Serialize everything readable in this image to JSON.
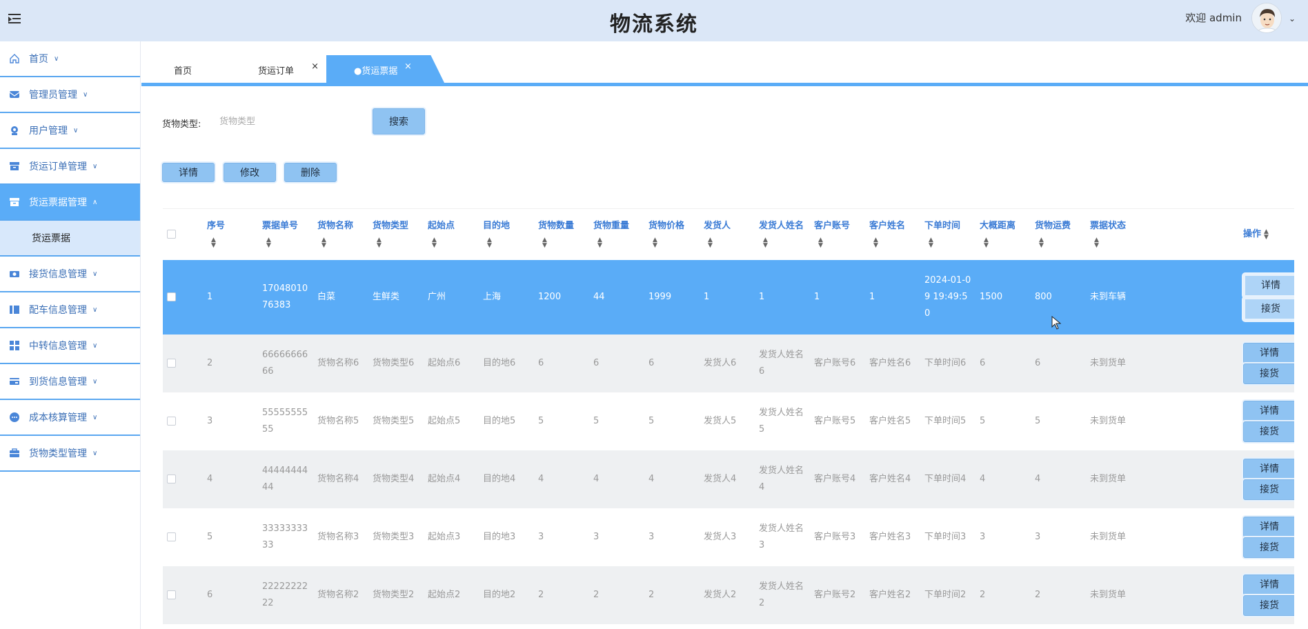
{
  "header": {
    "title": "物流系统",
    "welcome": "欢迎 admin"
  },
  "sidebar": {
    "items": [
      {
        "label": "首页",
        "icon": "home-icon"
      },
      {
        "label": "管理员管理",
        "icon": "admin-icon"
      },
      {
        "label": "用户管理",
        "icon": "user-icon"
      },
      {
        "label": "货运订单管理",
        "icon": "order-icon"
      },
      {
        "label": "货运票据管理",
        "icon": "ticket-icon",
        "active": true
      },
      {
        "label": "接货信息管理",
        "icon": "receive-icon"
      },
      {
        "label": "配车信息管理",
        "icon": "vehicle-icon"
      },
      {
        "label": "中转信息管理",
        "icon": "transfer-icon"
      },
      {
        "label": "到货信息管理",
        "icon": "arrival-icon"
      },
      {
        "label": "成本核算管理",
        "icon": "cost-icon"
      },
      {
        "label": "货物类型管理",
        "icon": "cargo-type-icon"
      }
    ],
    "sub_item": "货运票据"
  },
  "tabs": [
    {
      "label": "首页"
    },
    {
      "label": "货运订单",
      "close": "×"
    },
    {
      "label": "●货运票据",
      "close": "×",
      "active": true
    }
  ],
  "search": {
    "label": "货物类型:",
    "placeholder": "货物类型",
    "button": "搜索"
  },
  "actions": {
    "detail": "详情",
    "edit": "修改",
    "delete": "删除"
  },
  "table": {
    "columns": [
      "序号",
      "票据单号",
      "货物名称",
      "货物类型",
      "起始点",
      "目的地",
      "货物数量",
      "货物重量",
      "货物价格",
      "发货人",
      "发货人姓名",
      "客户账号",
      "客户姓名",
      "下单时间",
      "大概距离",
      "货物运费",
      "票据状态",
      "操作"
    ],
    "row_buttons": {
      "detail": "详情",
      "receive": "接货"
    },
    "rows": [
      {
        "cells": [
          "1",
          "1704801076383",
          "白菜",
          "生鲜类",
          "广州",
          "上海",
          "1200",
          "44",
          "1999",
          "1",
          "1",
          "1",
          "1",
          "2024-01-09 19:49:50",
          "1500",
          "800",
          "未到车辆"
        ],
        "selected": true
      },
      {
        "cells": [
          "2",
          "6666666666",
          "货物名称6",
          "货物类型6",
          "起始点6",
          "目的地6",
          "6",
          "6",
          "6",
          "发货人6",
          "发货人姓名6",
          "客户账号6",
          "客户姓名6",
          "下单时间6",
          "6",
          "6",
          "未到货单"
        ]
      },
      {
        "cells": [
          "3",
          "5555555555",
          "货物名称5",
          "货物类型5",
          "起始点5",
          "目的地5",
          "5",
          "5",
          "5",
          "发货人5",
          "发货人姓名5",
          "客户账号5",
          "客户姓名5",
          "下单时间5",
          "5",
          "5",
          "未到货单"
        ]
      },
      {
        "cells": [
          "4",
          "4444444444",
          "货物名称4",
          "货物类型4",
          "起始点4",
          "目的地4",
          "4",
          "4",
          "4",
          "发货人4",
          "发货人姓名4",
          "客户账号4",
          "客户姓名4",
          "下单时间4",
          "4",
          "4",
          "未到货单"
        ]
      },
      {
        "cells": [
          "5",
          "3333333333",
          "货物名称3",
          "货物类型3",
          "起始点3",
          "目的地3",
          "3",
          "3",
          "3",
          "发货人3",
          "发货人姓名3",
          "客户账号3",
          "客户姓名3",
          "下单时间3",
          "3",
          "3",
          "未到货单"
        ]
      },
      {
        "cells": [
          "6",
          "2222222222",
          "货物名称2",
          "货物类型2",
          "起始点2",
          "目的地2",
          "2",
          "2",
          "2",
          "发货人2",
          "发货人姓名2",
          "客户账号2",
          "客户姓名2",
          "下单时间2",
          "2",
          "2",
          "未到货单"
        ]
      }
    ]
  },
  "colors": {
    "accent": "#5aacf7",
    "header_bg": "#dbe7f7",
    "button": "#8fc3f2",
    "row_alt": "#eef0f2"
  }
}
